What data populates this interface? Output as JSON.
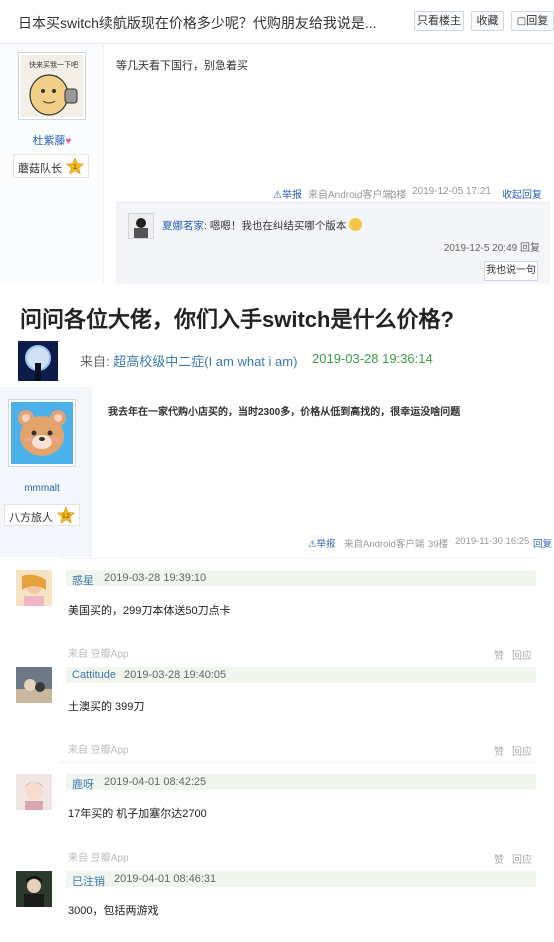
{
  "thread": {
    "title": "日本买switch续航版现在价格多少呢？代购朋友给我说是...",
    "buttons": {
      "only_op": "只看楼主",
      "favorite": "收藏",
      "reply": "回复"
    },
    "post": {
      "user": "杜紫藤",
      "rank": "蘑菇队长",
      "rank_level": "1",
      "content": "等几天看下国行，别急着买",
      "report": "举报",
      "source": "来自Android客户端",
      "floor": "3楼",
      "time": "2019-12-05 17:21",
      "reply_label": "收起回复"
    },
    "sub_reply": {
      "user": "夏娜茗家",
      "sep": ":",
      "text": "嗯嗯！我也在纠结买哪个版本",
      "time": "2019-12-5 20:49",
      "reply": "回复",
      "say_button": "我也说一句"
    }
  },
  "question": {
    "title": "问问各位大佬，你们入手switch是什么价格?",
    "from_label": "来自: ",
    "author": "超高校级中二症(I am what i am)",
    "time": "2019-03-28 19:36:14"
  },
  "post2": {
    "user": "mmmalt",
    "rank": "八方旅人",
    "rank_level": "12",
    "content": "我去年在一家代购小店买的，当时2300多，价格从低到高找的，很幸运没啥问题",
    "report": "举报",
    "source": "来自Android客户端",
    "floor": "39楼",
    "time": "2019-11-30 16:25",
    "reply": "回复"
  },
  "comments": [
    {
      "user": "惑星",
      "time": "2019-03-28 19:39:10",
      "text": "美国买的，299刀本体送50刀点卡",
      "source": "来自 豆瓣App",
      "like": "赞",
      "reply": "回应"
    },
    {
      "user": "Cattitude",
      "time": "2019-03-28 19:40:05",
      "text": "土澳买的 399刀",
      "source": "来自 豆瓣App",
      "like": "赞",
      "reply": "回应"
    },
    {
      "user": "鹿呀",
      "time": "2019-04-01 08:42:25",
      "text": "17年买的 机子加塞尔达2700",
      "source": "来自 豆瓣App",
      "like": "赞",
      "reply": "回应"
    },
    {
      "user": "已注销",
      "time": "2019-04-01 08:46:31",
      "text": "3000，包括两游戏"
    }
  ],
  "colors": {
    "link_blue": "#3d7ab3",
    "time_green": "#3aa048",
    "bar_green": "#f0f5ee",
    "rank_gold": "#f4b81f"
  }
}
